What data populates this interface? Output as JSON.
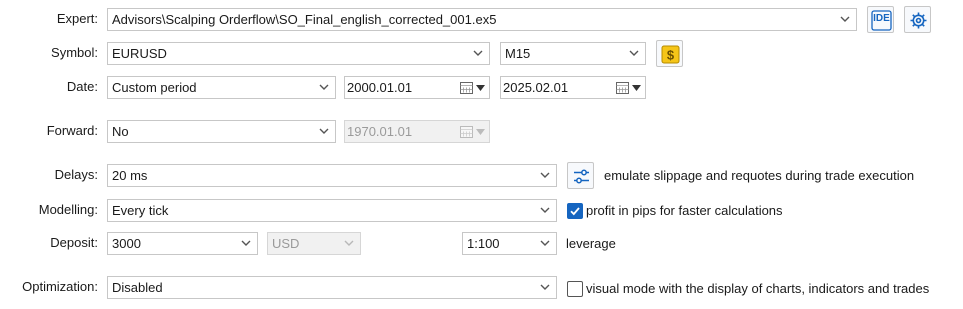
{
  "expert": {
    "label": "Expert:",
    "value": "Advisors\\Scalping Orderflow\\SO_Final_english_corrected_001.ex5",
    "ide_label": "IDE",
    "settings_icon": "gear-icon"
  },
  "symbol": {
    "label": "Symbol:",
    "value": "EURUSD",
    "timeframe": "M15",
    "symbols_icon": "dollar-icon"
  },
  "date": {
    "label": "Date:",
    "period": "Custom period",
    "from": "2000.01.01",
    "to": "2025.02.01"
  },
  "forward": {
    "label": "Forward:",
    "value": "No",
    "date": "1970.01.01"
  },
  "delays": {
    "label": "Delays:",
    "value": "20 ms",
    "description": "emulate slippage and requotes during trade execution"
  },
  "modelling": {
    "label": "Modelling:",
    "value": "Every tick",
    "pips_checkbox_label": "profit in pips for faster calculations",
    "pips_checked": true
  },
  "deposit": {
    "label": "Deposit:",
    "amount": "3000",
    "currency": "USD",
    "leverage_value": "1:100",
    "leverage_label": "leverage"
  },
  "optimization": {
    "label": "Optimization:",
    "value": "Disabled",
    "visual_checkbox_label": "visual mode with the display of charts, indicators and trades",
    "visual_checked": false
  },
  "colors": {
    "accent": "#1565c0",
    "coin": "#f5c518",
    "border": "#c7c7c7",
    "disabled_bg": "#f1f1f1"
  }
}
